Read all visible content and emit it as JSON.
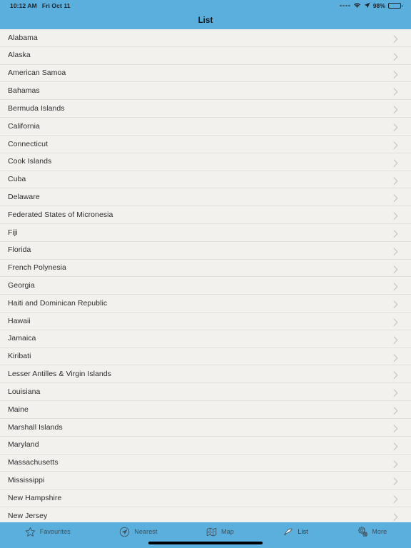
{
  "status_bar": {
    "time": "10:12 AM",
    "date": "Fri Oct 11",
    "signal_icon": "signal-dots-icon",
    "wifi_icon": "wifi-icon",
    "location_icon": "location-arrow-icon",
    "battery_percent": "98%",
    "battery_icon": "battery-icon",
    "battery_level": 98
  },
  "navbar": {
    "title": "List",
    "background_color": "#5aafdd",
    "title_color": "#14181c"
  },
  "list": {
    "background_color": "#f3f1ed",
    "separator_color": "#e2e0db",
    "chevron_icon": "chevron-right-icon",
    "items": [
      {
        "label": "Alabama"
      },
      {
        "label": "Alaska"
      },
      {
        "label": "American Samoa"
      },
      {
        "label": "Bahamas"
      },
      {
        "label": "Bermuda Islands"
      },
      {
        "label": "California"
      },
      {
        "label": "Connecticut"
      },
      {
        "label": "Cook Islands"
      },
      {
        "label": "Cuba"
      },
      {
        "label": "Delaware"
      },
      {
        "label": "Federated States of Micronesia"
      },
      {
        "label": "Fiji"
      },
      {
        "label": "Florida"
      },
      {
        "label": "French Polynesia"
      },
      {
        "label": "Georgia"
      },
      {
        "label": "Haiti and Dominican Republic"
      },
      {
        "label": "Hawaii"
      },
      {
        "label": "Jamaica"
      },
      {
        "label": "Kiribati"
      },
      {
        "label": "Lesser Antilles & Virgin Islands"
      },
      {
        "label": "Louisiana"
      },
      {
        "label": "Maine"
      },
      {
        "label": "Marshall Islands"
      },
      {
        "label": "Maryland"
      },
      {
        "label": "Massachusetts"
      },
      {
        "label": "Mississippi"
      },
      {
        "label": "New Hampshire"
      },
      {
        "label": "New Jersey"
      }
    ]
  },
  "tabbar": {
    "background_color": "#5aafdd",
    "active_tab": "List",
    "tabs": [
      {
        "label": "Favourites",
        "icon": "star-icon",
        "active": false
      },
      {
        "label": "Nearest",
        "icon": "location-arrow-circle-icon",
        "active": false
      },
      {
        "label": "Map",
        "icon": "folded-map-icon",
        "active": false
      },
      {
        "label": "List",
        "icon": "fish-icon",
        "active": true
      },
      {
        "label": "More",
        "icon": "gears-icon",
        "active": false
      }
    ]
  },
  "home_indicator": {
    "name": "home-indicator"
  }
}
